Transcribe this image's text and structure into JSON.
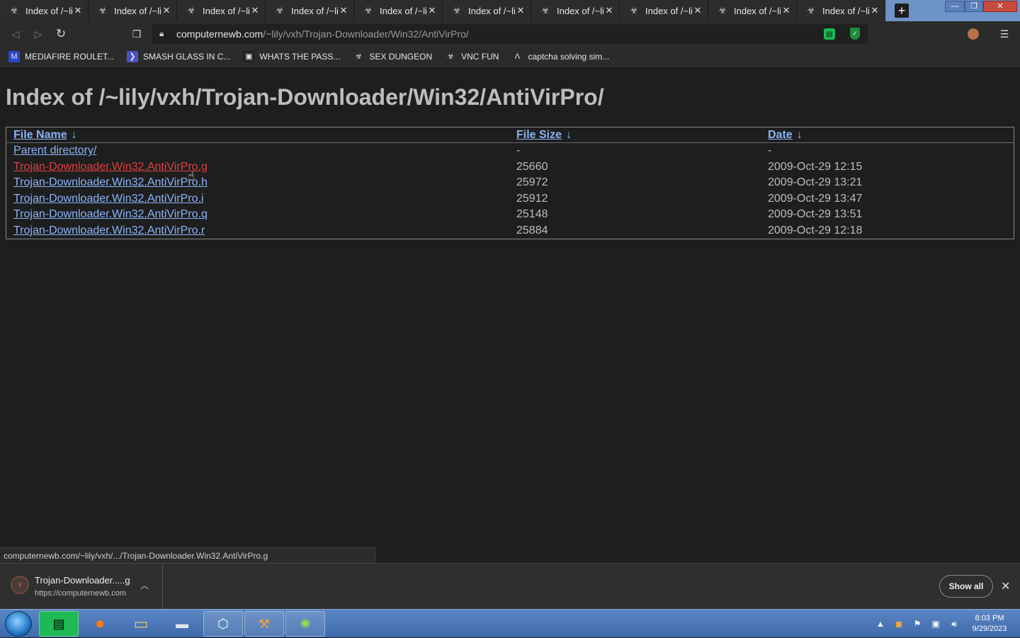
{
  "tabs": [
    {
      "title": "Index of /~lil"
    },
    {
      "title": "Index of /~lil"
    },
    {
      "title": "Index of /~lil"
    },
    {
      "title": "Index of /~lil"
    },
    {
      "title": "Index of /~lil"
    },
    {
      "title": "Index of /~lil"
    },
    {
      "title": "Index of /~lil"
    },
    {
      "title": "Index of /~lil"
    },
    {
      "title": "Index of /~lil"
    },
    {
      "title": "Index of /~lil"
    }
  ],
  "address_bar": {
    "host": "computernewb.com",
    "path": "/~lily/vxh/Trojan-Downloader/Win32/AntiVirPro/"
  },
  "bookmarks": [
    {
      "label": "MEDIAFIRE ROULET...",
      "icon": "mediafire-icon"
    },
    {
      "label": "SMASH GLASS IN C...",
      "icon": "chevron-icon"
    },
    {
      "label": "WHATS THE PASS...",
      "icon": "computer-icon"
    },
    {
      "label": "SEX DUNGEON",
      "icon": "globe-icon"
    },
    {
      "label": "VNC FUN",
      "icon": "globe-icon"
    },
    {
      "label": "captcha solving sim...",
      "icon": "lambda-icon"
    }
  ],
  "page": {
    "heading": "Index of /~lily/vxh/Trojan-Downloader/Win32/AntiVirPro/",
    "columns": {
      "name": "File Name",
      "size": "File Size",
      "date": "Date",
      "sort_glyph": "↓"
    },
    "parent": {
      "name": "Parent directory/",
      "size": "-",
      "date": "-"
    },
    "rows": [
      {
        "name": "Trojan-Downloader.Win32.AntiVirPro.g",
        "size": "25660",
        "date": "2009-Oct-29 12:15",
        "visited": true
      },
      {
        "name": "Trojan-Downloader.Win32.AntiVirPro.h",
        "size": "25972",
        "date": "2009-Oct-29 13:21",
        "visited": false
      },
      {
        "name": "Trojan-Downloader.Win32.AntiVirPro.i",
        "size": "25912",
        "date": "2009-Oct-29 13:47",
        "visited": false
      },
      {
        "name": "Trojan-Downloader.Win32.AntiVirPro.q",
        "size": "25148",
        "date": "2009-Oct-29 13:51",
        "visited": false
      },
      {
        "name": "Trojan-Downloader.Win32.AntiVirPro.r",
        "size": "25884",
        "date": "2009-Oct-29 12:18",
        "visited": false
      }
    ]
  },
  "status_bubble": "computernewb.com/~lily/vxh/.../Trojan-Downloader.Win32.AntiVirPro.g",
  "download_shelf": {
    "file_name": "Trojan-Downloader.....g",
    "source": "https://computernewb.com",
    "show_all": "Show all"
  },
  "taskbar": {
    "apps": [
      "chat-app",
      "firefox",
      "file-explorer",
      "window-app",
      "virtualbox",
      "hammer-app",
      "lime-app"
    ],
    "clock_time": "8:03 PM",
    "clock_date": "9/29/2023"
  },
  "colors": {
    "link": "#8ab4f8",
    "visited_link": "#e04040",
    "background": "#1e1e1e",
    "taskbar": "#4a76b8"
  }
}
